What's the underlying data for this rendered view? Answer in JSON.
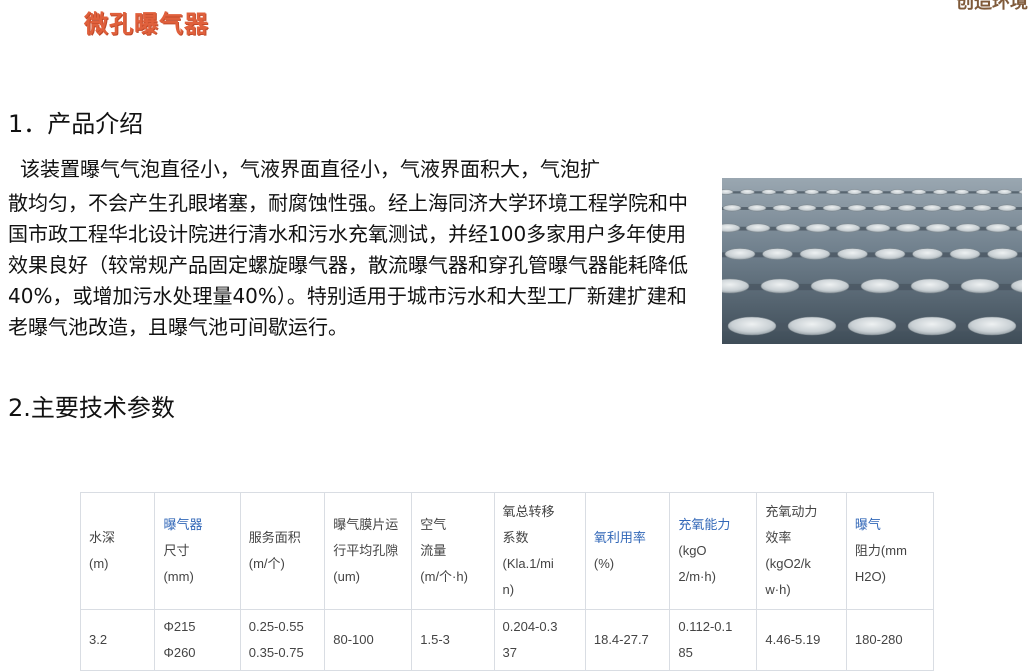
{
  "header": {
    "product_title": "微孔曝气器",
    "corner_text": "创造环境"
  },
  "section1": {
    "heading": "1．产品介绍",
    "first_line": "该装置曝气气泡直径小，气液界面直径小，气液界面积大，气泡扩",
    "body": "散均匀，不会产生孔眼堵塞，耐腐蚀性强。经上海同济大学环境工程学院和中国市政工程华北设计院进行清水和污水充氧测试，并经100多家用户多年使用效果良好（较常规产品固定螺旋曝气器，散流曝气器和穿孔管曝气器能耗降低40%，或增加污水处理量40%）。特别适用于城市污水和大型工厂新建扩建和老曝气池改造，且曝气池可间歇运行。"
  },
  "section2": {
    "heading": "2.主要技术参数"
  },
  "colors": {
    "title": "#e0603c",
    "link": "#3368b8",
    "border": "#d9dde3"
  },
  "table": {
    "headers": [
      {
        "lines": [
          {
            "text": "水深",
            "link": false
          },
          {
            "text": "(m)",
            "link": false
          }
        ]
      },
      {
        "lines": [
          {
            "text": "曝气器",
            "link": true
          },
          {
            "text": "尺寸",
            "link": false
          },
          {
            "text": "(mm)",
            "link": false
          }
        ]
      },
      {
        "lines": [
          {
            "text": "服务面积",
            "link": false
          },
          {
            "text": "(m/个)",
            "link": false
          }
        ]
      },
      {
        "lines": [
          {
            "text": "曝气膜片运",
            "link": false
          },
          {
            "text": "行平均孔隙",
            "link": false
          },
          {
            "text": "(um)",
            "link": false
          }
        ]
      },
      {
        "lines": [
          {
            "text": "空气",
            "link": false
          },
          {
            "text": "流量",
            "link": false
          },
          {
            "text": "(m/个·h)",
            "link": false
          }
        ]
      },
      {
        "lines": [
          {
            "text": "氧总转移",
            "link": false
          },
          {
            "text": "系数",
            "link": false
          },
          {
            "text": "(Kla.1/mi",
            "link": false
          },
          {
            "text": "n)",
            "link": false
          }
        ]
      },
      {
        "lines": [
          {
            "text": "氧利用率",
            "link": true
          },
          {
            "text": "(%)",
            "link": false
          }
        ]
      },
      {
        "lines": [
          {
            "text": "充氧能力",
            "link": true
          },
          {
            "text": "(kgO",
            "link": false
          },
          {
            "text": "2/m·h)",
            "link": false
          }
        ]
      },
      {
        "lines": [
          {
            "text": "充氧动力",
            "link": false
          },
          {
            "text": "效率",
            "link": false
          },
          {
            "text": "(kgO2/k",
            "link": false
          },
          {
            "text": "w·h)",
            "link": false
          }
        ]
      },
      {
        "lines": [
          {
            "text": "曝气",
            "link": true
          },
          {
            "text": "阻力(mm",
            "link": false
          },
          {
            "text": "H2O)",
            "link": false
          }
        ]
      }
    ],
    "row": [
      [
        "3.2"
      ],
      [
        "Φ215",
        "Φ260"
      ],
      [
        "0.25-0.55",
        "0.35-0.75"
      ],
      [
        "80-100"
      ],
      [
        "1.5-3"
      ],
      [
        "0.204-0.3",
        "37"
      ],
      [
        "18.4-27.7"
      ],
      [
        "0.112-0.1",
        "85"
      ],
      [
        "4.46-5.19"
      ],
      [
        "180-280"
      ]
    ]
  }
}
